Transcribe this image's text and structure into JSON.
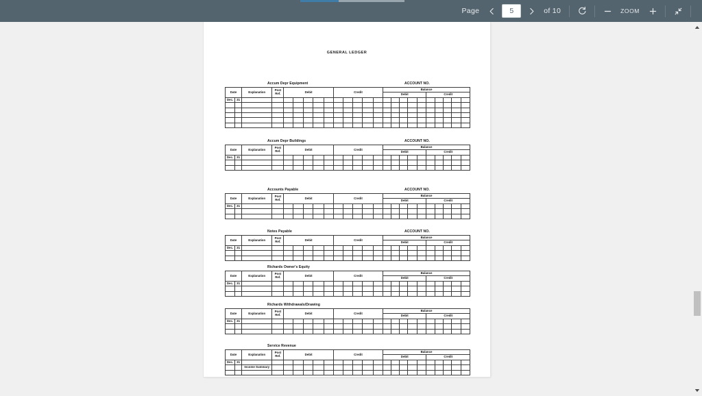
{
  "toolbar": {
    "page_label": "Page",
    "prev_icon": "chevron-left-icon",
    "page_value": "5",
    "next_icon": "chevron-right-icon",
    "of_label": "of 10",
    "rotate_icon": "rotate-icon",
    "zoom_out_icon": "minus-icon",
    "zoom_label": "ZOOM",
    "zoom_in_icon": "plus-icon",
    "fullscreen_icon": "expand-collapse-icon",
    "bar_color": "#54646f",
    "accent_color": "#3f7ca8"
  },
  "document": {
    "title": "GENERAL LEDGER",
    "account_no_label": "ACCOUNT NO.",
    "columns": {
      "date": "Date",
      "explanation": "Explanation",
      "post_ref_line1": "Post",
      "post_ref_line2": "Ref.",
      "debit": "Debit",
      "credit": "Credit",
      "balance": "Balance",
      "balance_debit": "Debit",
      "balance_credit": "Credit"
    },
    "ledgers": [
      {
        "account_name": "Accum Depr Equipment",
        "show_account_no": true,
        "rows": [
          {
            "month": "Dec.",
            "day": "31",
            "explanation": ""
          },
          {
            "month": "",
            "day": "",
            "explanation": ""
          },
          {
            "month": "",
            "day": "",
            "explanation": ""
          },
          {
            "month": "",
            "day": "",
            "explanation": ""
          },
          {
            "month": "",
            "day": "",
            "explanation": ""
          },
          {
            "month": "",
            "day": "",
            "explanation": ""
          }
        ]
      },
      {
        "account_name": "Accum Depr Buildings",
        "show_account_no": true,
        "rows": [
          {
            "month": "Dec.",
            "day": "31",
            "explanation": ""
          },
          {
            "month": "",
            "day": "",
            "explanation": ""
          },
          {
            "month": "",
            "day": "",
            "explanation": ""
          }
        ]
      },
      {
        "account_name": "Accounts Payable",
        "show_account_no": true,
        "rows": [
          {
            "month": "Dec.",
            "day": "31",
            "explanation": ""
          },
          {
            "month": "",
            "day": "",
            "explanation": ""
          },
          {
            "month": "",
            "day": "",
            "explanation": ""
          }
        ]
      },
      {
        "account_name": "Notes Payable",
        "show_account_no": true,
        "rows": [
          {
            "month": "Dec.",
            "day": "31",
            "explanation": ""
          },
          {
            "month": "",
            "day": "",
            "explanation": ""
          },
          {
            "month": "",
            "day": "",
            "explanation": ""
          }
        ]
      },
      {
        "account_name": "Richards Owner's Equity",
        "show_account_no": false,
        "rows": [
          {
            "month": "Dec.",
            "day": "31",
            "explanation": ""
          },
          {
            "month": "",
            "day": "",
            "explanation": ""
          },
          {
            "month": "",
            "day": "",
            "explanation": ""
          }
        ]
      },
      {
        "account_name": "Richards Withdrawals/Drawing",
        "show_account_no": false,
        "rows": [
          {
            "month": "Dec.",
            "day": "31",
            "explanation": ""
          },
          {
            "month": "",
            "day": "",
            "explanation": ""
          },
          {
            "month": "",
            "day": "",
            "explanation": ""
          }
        ]
      },
      {
        "account_name": "Service Revenue",
        "show_account_no": false,
        "rows": [
          {
            "month": "Dec.",
            "day": "31",
            "explanation": ""
          },
          {
            "month": "",
            "day": "",
            "explanation": "Income Summary"
          },
          {
            "month": "",
            "day": "",
            "explanation": ""
          }
        ]
      }
    ]
  }
}
